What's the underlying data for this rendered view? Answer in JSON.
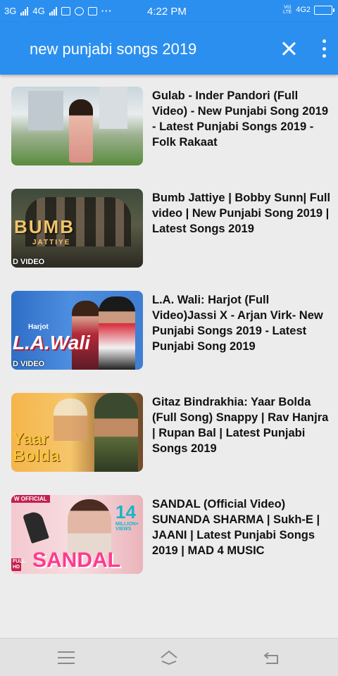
{
  "status_bar": {
    "signal1": "3G",
    "signal2": "4G",
    "time": "4:22 PM",
    "volte": "Vo) LTE",
    "network": "4G2",
    "icons": [
      "signal-icon",
      "signal-icon",
      "message-icon",
      "chat-icon",
      "bag-icon",
      "more-dots-icon",
      "battery-icon"
    ]
  },
  "app_bar": {
    "query": "new punjabi songs 2019",
    "close_icon": "close-icon",
    "more_icon": "more-vertical-icon"
  },
  "results": [
    {
      "title": "Gulab - Inder Pandori (Full Video) - New Punjabi Song 2019 - Latest Punjabi Songs 2019 - Folk Rakaat",
      "overlay": "",
      "badge": ""
    },
    {
      "title": "Bumb Jattiye | Bobby Sunn| Full video | New Punjabi Song 2019 | Latest Songs 2019",
      "overlay": "BUMB",
      "overlay_sub": "JATTIYE",
      "badge": "D VIDEO"
    },
    {
      "title": "L.A. Wali: Harjot (Full Video)Jassi X - Arjan Virk- New Punjabi Songs 2019 - Latest Punjabi Song 2019",
      "overlay": "L.A.Wali",
      "overlay_tag": "Harjot",
      "badge": "D VIDEO"
    },
    {
      "title": "Gitaz Bindrakhia: Yaar Bolda (Full Song) Snappy | Rav Hanjra | Rupan Bal | Latest Punjabi Songs 2019",
      "overlay": "Yaar Bolda",
      "badge": ""
    },
    {
      "title": "SANDAL (Official Video) SUNANDA SHARMA | Sukh-E | JAANI | Latest Punjabi Songs 2019 | MAD 4 MUSIC",
      "overlay": "SANDAL",
      "views_number": "14",
      "views_label": "MILLION+ VIEWS",
      "corner_tag": "W OFFICIAL",
      "hd_tag": "FULL HD"
    }
  ],
  "nav_bar": {
    "menu_icon": "menu-icon",
    "home_icon": "home-icon",
    "back_icon": "back-icon"
  },
  "colors": {
    "app_bar": "#2b8ff0",
    "background": "#ececec",
    "nav_bar": "#e2e2e2"
  }
}
